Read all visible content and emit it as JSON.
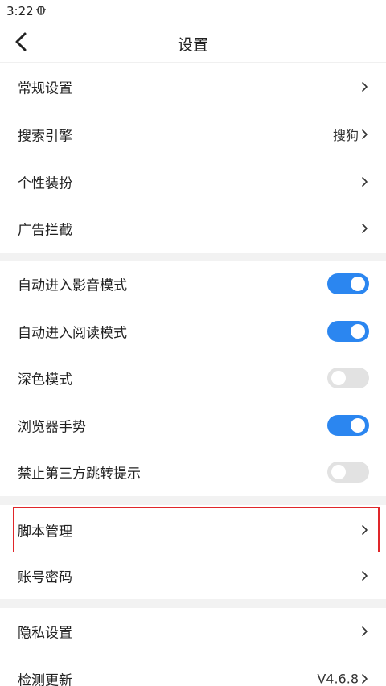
{
  "status_bar": {
    "time": "3:22",
    "notification_icon": "bug-icon"
  },
  "header": {
    "title": "设置",
    "back_icon": "back-arrow-icon"
  },
  "section1": [
    {
      "label": "常规设置",
      "value": ""
    },
    {
      "label": "搜索引擎",
      "value": "搜狗"
    },
    {
      "label": "个性装扮",
      "value": ""
    },
    {
      "label": "广告拦截",
      "value": ""
    }
  ],
  "section2": [
    {
      "label": "自动进入影音模式",
      "on": true
    },
    {
      "label": "自动进入阅读模式",
      "on": true
    },
    {
      "label": "深色模式",
      "on": false
    },
    {
      "label": "浏览器手势",
      "on": true
    },
    {
      "label": "禁止第三方跳转提示",
      "on": false
    }
  ],
  "section3": [
    {
      "label": "脚本管理",
      "value": ""
    },
    {
      "label": "账号密码",
      "value": ""
    }
  ],
  "section4": [
    {
      "label": "隐私设置",
      "value": ""
    },
    {
      "label": "检测更新",
      "value": "V4.6.8"
    }
  ],
  "colors": {
    "toggle_on": "#2b86f0",
    "toggle_off": "#e2e2e2",
    "highlight": "#e0262a",
    "divider": "#f2f2f2"
  }
}
